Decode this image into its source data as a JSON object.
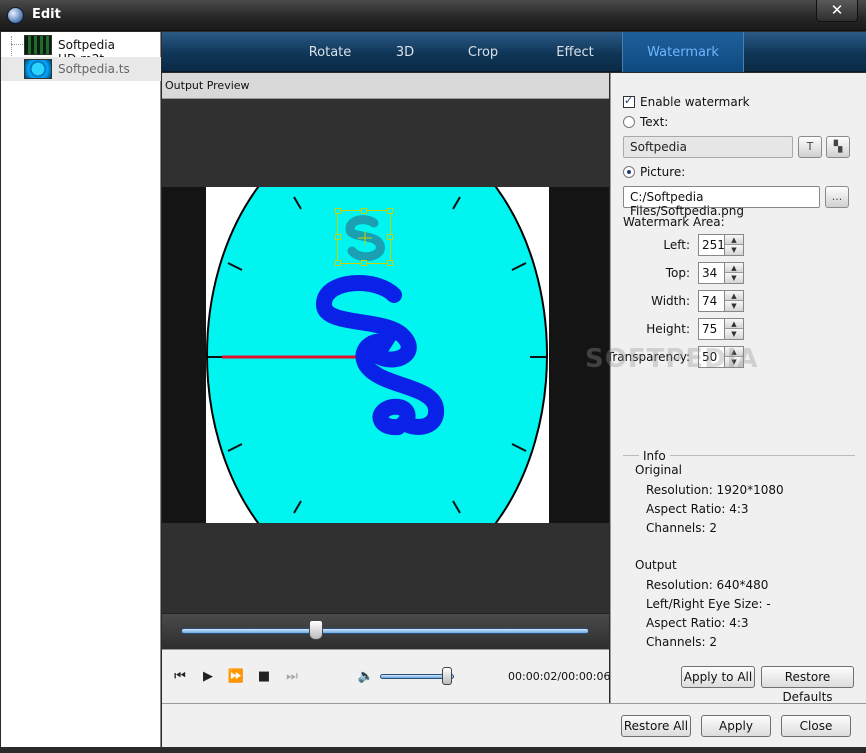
{
  "window": {
    "title": "Edit",
    "close_label": "✕"
  },
  "files": [
    {
      "name": "Softpedia HD.m2t",
      "selected": false
    },
    {
      "name": "Softpedia.ts",
      "selected": true
    }
  ],
  "tabs": [
    {
      "label": "Rotate",
      "active": false
    },
    {
      "label": "3D",
      "active": false
    },
    {
      "label": "Crop",
      "active": false
    },
    {
      "label": "Effect",
      "active": false
    },
    {
      "label": "Watermark",
      "active": true
    }
  ],
  "preview": {
    "header": "Output Preview",
    "seek_progress": 0.33,
    "volume_level": 0.9,
    "time": "00:00:02/00:00:06"
  },
  "icons": [
    "app-icon",
    "close-icon",
    "file-thumbnail",
    "skip-back-icon",
    "play-icon",
    "fast-forward-icon",
    "stop-icon",
    "skip-forward-icon",
    "volume-icon",
    "text-format-icon",
    "text-style-icon",
    "browse-icon"
  ],
  "watermark": {
    "enable_label": "Enable watermark",
    "enable_checked": true,
    "text_label": "Text:",
    "text_value": "Softpedia",
    "text_selected": false,
    "picture_label": "Picture:",
    "picture_selected": true,
    "picture_path": "C:/Softpedia Files/Softpedia.png",
    "browse_label": "...",
    "area_label": "Watermark Area:",
    "fields": [
      {
        "label": "Left:",
        "value": "251"
      },
      {
        "label": "Top:",
        "value": "34"
      },
      {
        "label": "Width:",
        "value": "74"
      },
      {
        "label": "Height:",
        "value": "75"
      },
      {
        "label": "Transparency:",
        "value": "50"
      }
    ]
  },
  "info": {
    "title": "Info",
    "original_label": "Original",
    "original": [
      "Resolution: 1920*1080",
      "Aspect Ratio: 4:3",
      "Channels: 2"
    ],
    "output_label": "Output",
    "output": [
      "Resolution: 640*480",
      "Left/Right Eye Size: -",
      "Aspect Ratio: 4:3",
      "Channels: 2"
    ]
  },
  "buttons": {
    "apply_to_all": "Apply to All",
    "restore_defaults": "Restore Defaults",
    "restore_all": "Restore All",
    "apply": "Apply",
    "close": "Close"
  },
  "watermark_ghost": "SOFTPEDIA",
  "colors": {
    "tab_bar": "#0f3657",
    "active_tab_text": "#6fb6ff",
    "clock_face": "#00f5f0",
    "logo_blue": "#0a22e8"
  }
}
